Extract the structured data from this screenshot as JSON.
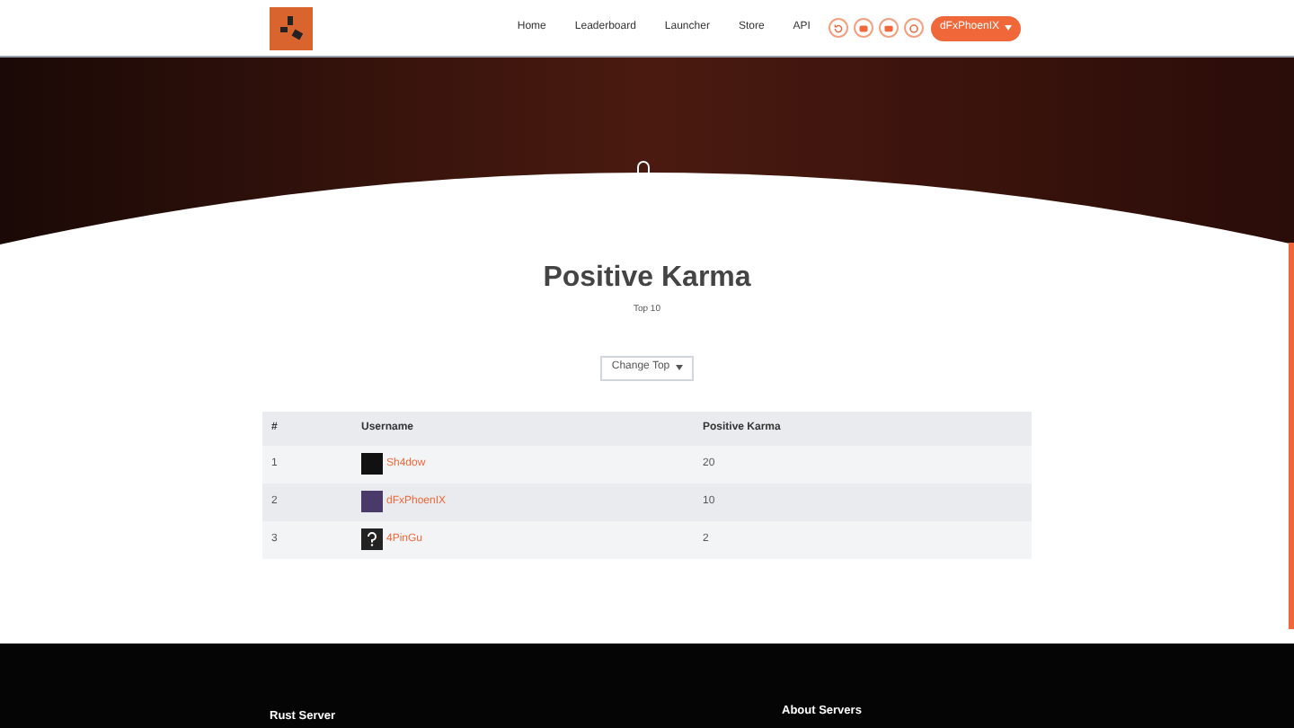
{
  "nav": {
    "links": [
      {
        "label": "Home"
      },
      {
        "label": "Leaderboard"
      },
      {
        "label": "Launcher"
      },
      {
        "label": "Store"
      },
      {
        "label": "API"
      }
    ],
    "social": [
      {
        "kind": "refresh"
      },
      {
        "kind": "discord"
      },
      {
        "kind": "youtube"
      },
      {
        "kind": "steam"
      }
    ],
    "user": "dFxPhoenIX"
  },
  "heading": {
    "title": "Positive Karma",
    "subtitle": "Top 10",
    "dropdown": "Change Top"
  },
  "table": {
    "columns": [
      "#",
      "Username",
      "Positive Karma"
    ],
    "rows": [
      {
        "rank": "1",
        "username": "Sh4dow",
        "karma": "20",
        "kind": "dark"
      },
      {
        "rank": "2",
        "username": "dFxPhoenIX",
        "karma": "10",
        "kind": "purple"
      },
      {
        "rank": "3",
        "username": "4PinGu",
        "karma": "2",
        "kind": "unknown"
      }
    ]
  },
  "footer": {
    "columns": [
      {
        "title": "Rust Server"
      },
      {
        "title": "About Servers"
      }
    ]
  }
}
